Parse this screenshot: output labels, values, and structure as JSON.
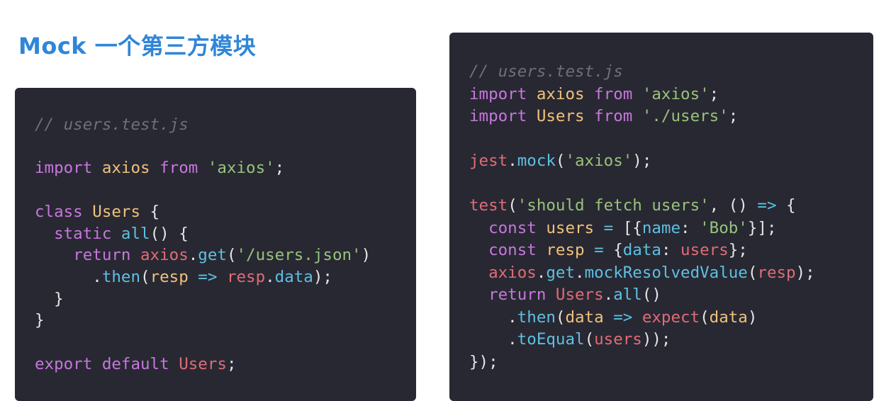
{
  "title": "Mock 一个第三方模块",
  "left_code": [
    [
      {
        "t": "// users.test.js",
        "c": "comment"
      }
    ],
    [],
    [
      {
        "t": "import",
        "c": "kw"
      },
      {
        "t": " ",
        "c": "punc"
      },
      {
        "t": "axios",
        "c": "ident"
      },
      {
        "t": " ",
        "c": "punc"
      },
      {
        "t": "from",
        "c": "kw"
      },
      {
        "t": " ",
        "c": "punc"
      },
      {
        "t": "'axios'",
        "c": "str"
      },
      {
        "t": ";",
        "c": "punc"
      }
    ],
    [],
    [
      {
        "t": "class",
        "c": "kw"
      },
      {
        "t": " ",
        "c": "punc"
      },
      {
        "t": "Users",
        "c": "ident"
      },
      {
        "t": " {",
        "c": "punc"
      }
    ],
    [
      {
        "t": "  ",
        "c": "punc"
      },
      {
        "t": "static",
        "c": "kw"
      },
      {
        "t": " ",
        "c": "punc"
      },
      {
        "t": "all",
        "c": "fn"
      },
      {
        "t": "() {",
        "c": "punc"
      }
    ],
    [
      {
        "t": "    ",
        "c": "punc"
      },
      {
        "t": "return",
        "c": "kw"
      },
      {
        "t": " ",
        "c": "punc"
      },
      {
        "t": "axios",
        "c": "call"
      },
      {
        "t": ".",
        "c": "punc"
      },
      {
        "t": "get",
        "c": "fn"
      },
      {
        "t": "(",
        "c": "punc"
      },
      {
        "t": "'/users.json'",
        "c": "str"
      },
      {
        "t": ")",
        "c": "punc"
      }
    ],
    [
      {
        "t": "      .",
        "c": "punc"
      },
      {
        "t": "then",
        "c": "fn"
      },
      {
        "t": "(",
        "c": "punc"
      },
      {
        "t": "resp",
        "c": "ident"
      },
      {
        "t": " ",
        "c": "punc"
      },
      {
        "t": "=>",
        "c": "op"
      },
      {
        "t": " ",
        "c": "punc"
      },
      {
        "t": "resp",
        "c": "call"
      },
      {
        "t": ".",
        "c": "punc"
      },
      {
        "t": "data",
        "c": "fn"
      },
      {
        "t": ");",
        "c": "punc"
      }
    ],
    [
      {
        "t": "  }",
        "c": "punc"
      }
    ],
    [
      {
        "t": "}",
        "c": "punc"
      }
    ],
    [],
    [
      {
        "t": "export",
        "c": "kw"
      },
      {
        "t": " ",
        "c": "punc"
      },
      {
        "t": "default",
        "c": "kw"
      },
      {
        "t": " ",
        "c": "punc"
      },
      {
        "t": "Users",
        "c": "call"
      },
      {
        "t": ";",
        "c": "punc"
      }
    ]
  ],
  "right_code": [
    [
      {
        "t": "// users.test.js",
        "c": "comment"
      }
    ],
    [
      {
        "t": "import",
        "c": "kw"
      },
      {
        "t": " ",
        "c": "punc"
      },
      {
        "t": "axios",
        "c": "ident"
      },
      {
        "t": " ",
        "c": "punc"
      },
      {
        "t": "from",
        "c": "kw"
      },
      {
        "t": " ",
        "c": "punc"
      },
      {
        "t": "'axios'",
        "c": "str"
      },
      {
        "t": ";",
        "c": "punc"
      }
    ],
    [
      {
        "t": "import",
        "c": "kw"
      },
      {
        "t": " ",
        "c": "punc"
      },
      {
        "t": "Users",
        "c": "ident"
      },
      {
        "t": " ",
        "c": "punc"
      },
      {
        "t": "from",
        "c": "kw"
      },
      {
        "t": " ",
        "c": "punc"
      },
      {
        "t": "'./users'",
        "c": "str"
      },
      {
        "t": ";",
        "c": "punc"
      }
    ],
    [],
    [
      {
        "t": "jest",
        "c": "call"
      },
      {
        "t": ".",
        "c": "punc"
      },
      {
        "t": "mock",
        "c": "fn"
      },
      {
        "t": "(",
        "c": "punc"
      },
      {
        "t": "'axios'",
        "c": "str"
      },
      {
        "t": ");",
        "c": "punc"
      }
    ],
    [],
    [
      {
        "t": "test",
        "c": "call"
      },
      {
        "t": "(",
        "c": "punc"
      },
      {
        "t": "'should fetch users'",
        "c": "str"
      },
      {
        "t": ", () ",
        "c": "punc"
      },
      {
        "t": "=>",
        "c": "op"
      },
      {
        "t": " {",
        "c": "punc"
      }
    ],
    [
      {
        "t": "  ",
        "c": "punc"
      },
      {
        "t": "const",
        "c": "kw"
      },
      {
        "t": " ",
        "c": "punc"
      },
      {
        "t": "users",
        "c": "ident"
      },
      {
        "t": " ",
        "c": "punc"
      },
      {
        "t": "=",
        "c": "op"
      },
      {
        "t": " [{",
        "c": "punc"
      },
      {
        "t": "name",
        "c": "fn"
      },
      {
        "t": ": ",
        "c": "punc"
      },
      {
        "t": "'Bob'",
        "c": "str"
      },
      {
        "t": "}];",
        "c": "punc"
      }
    ],
    [
      {
        "t": "  ",
        "c": "punc"
      },
      {
        "t": "const",
        "c": "kw"
      },
      {
        "t": " ",
        "c": "punc"
      },
      {
        "t": "resp",
        "c": "ident"
      },
      {
        "t": " ",
        "c": "punc"
      },
      {
        "t": "=",
        "c": "op"
      },
      {
        "t": " {",
        "c": "punc"
      },
      {
        "t": "data",
        "c": "fn"
      },
      {
        "t": ": ",
        "c": "punc"
      },
      {
        "t": "users",
        "c": "call"
      },
      {
        "t": "};",
        "c": "punc"
      }
    ],
    [
      {
        "t": "  ",
        "c": "punc"
      },
      {
        "t": "axios",
        "c": "call"
      },
      {
        "t": ".",
        "c": "punc"
      },
      {
        "t": "get",
        "c": "fn"
      },
      {
        "t": ".",
        "c": "punc"
      },
      {
        "t": "mockResolvedValue",
        "c": "fn"
      },
      {
        "t": "(",
        "c": "punc"
      },
      {
        "t": "resp",
        "c": "call"
      },
      {
        "t": ");",
        "c": "punc"
      }
    ],
    [
      {
        "t": "  ",
        "c": "punc"
      },
      {
        "t": "return",
        "c": "kw"
      },
      {
        "t": " ",
        "c": "punc"
      },
      {
        "t": "Users",
        "c": "call"
      },
      {
        "t": ".",
        "c": "punc"
      },
      {
        "t": "all",
        "c": "fn"
      },
      {
        "t": "()",
        "c": "punc"
      }
    ],
    [
      {
        "t": "    .",
        "c": "punc"
      },
      {
        "t": "then",
        "c": "fn"
      },
      {
        "t": "(",
        "c": "punc"
      },
      {
        "t": "data",
        "c": "ident"
      },
      {
        "t": " ",
        "c": "punc"
      },
      {
        "t": "=>",
        "c": "op"
      },
      {
        "t": " ",
        "c": "punc"
      },
      {
        "t": "expect",
        "c": "call"
      },
      {
        "t": "(",
        "c": "punc"
      },
      {
        "t": "data",
        "c": "ident"
      },
      {
        "t": ")",
        "c": "punc"
      }
    ],
    [
      {
        "t": "    .",
        "c": "punc"
      },
      {
        "t": "toEqual",
        "c": "fn"
      },
      {
        "t": "(",
        "c": "punc"
      },
      {
        "t": "users",
        "c": "call"
      },
      {
        "t": "));",
        "c": "punc"
      }
    ],
    [
      {
        "t": "});",
        "c": "punc"
      }
    ]
  ]
}
